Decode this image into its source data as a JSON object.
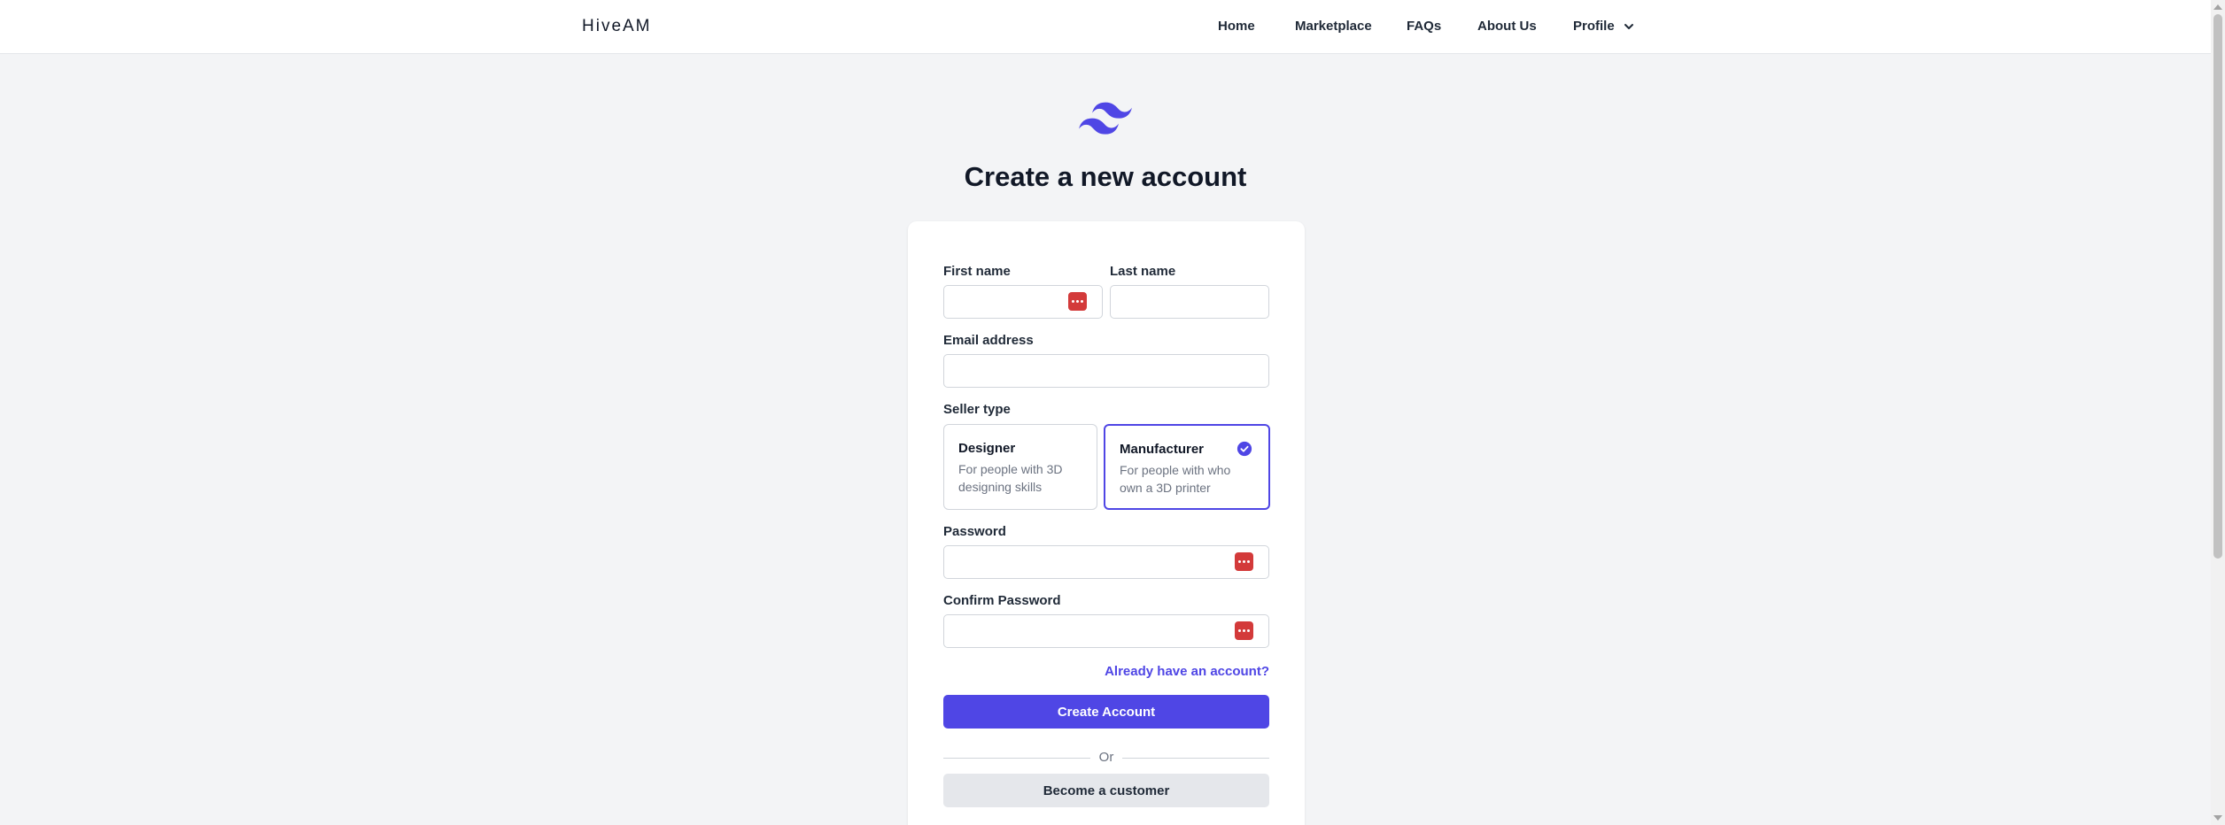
{
  "nav": {
    "brand": "HiveAM",
    "links": [
      "Home",
      "Marketplace",
      "FAQs",
      "About Us"
    ],
    "profile_label": "Profile"
  },
  "page": {
    "title": "Create a new account"
  },
  "form": {
    "first_name_label": "First name",
    "first_name_value": "",
    "last_name_label": "Last name",
    "last_name_value": "",
    "email_label": "Email address",
    "email_value": "",
    "seller_type_label": "Seller type",
    "seller_types": [
      {
        "title": "Designer",
        "description": "For people with 3D designing skills",
        "selected": false
      },
      {
        "title": "Manufacturer",
        "description": "For people with who own a 3D printer",
        "selected": true
      }
    ],
    "password_label": "Password",
    "password_value": "",
    "confirm_password_label": "Confirm Password",
    "confirm_password_value": "",
    "login_link": "Already have an account?",
    "submit_label": "Create Account",
    "divider_label": "Or",
    "customer_label": "Become a customer"
  },
  "colors": {
    "accent": "#4f46e5",
    "password_manager_badge": "#d33a3a",
    "background": "#f3f4f6"
  },
  "icons": [
    "tailwind-logo-icon",
    "chevron-down-icon",
    "password-manager-icon",
    "check-circle-icon"
  ]
}
